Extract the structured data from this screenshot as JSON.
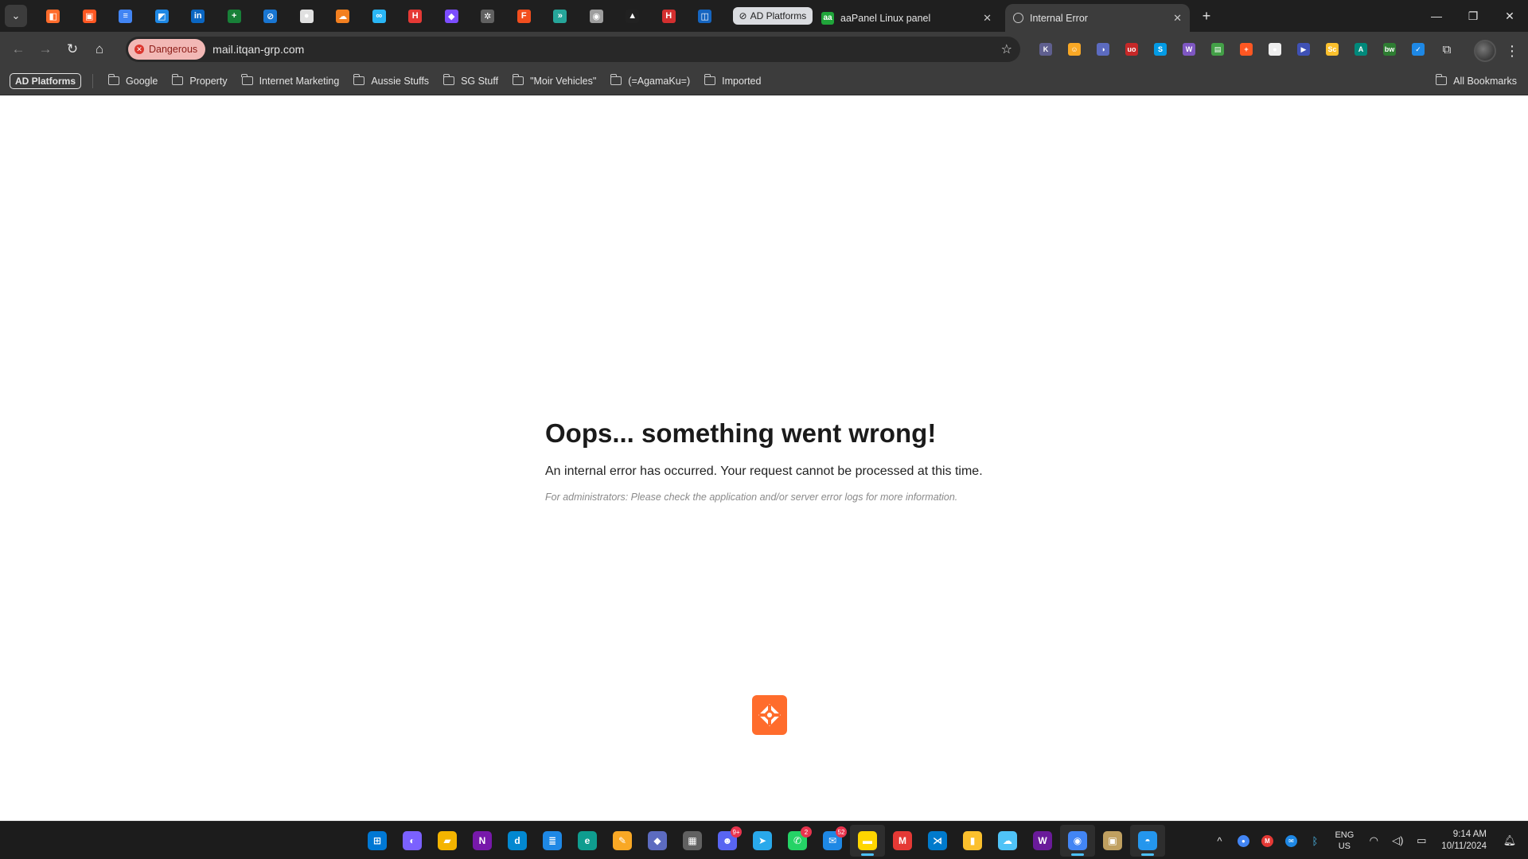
{
  "tabs": {
    "pinned_icons": [
      {
        "name": "pinned-tab-icon-1",
        "glyph": "◧",
        "color": "#ff6c2c"
      },
      {
        "name": "pinned-tab-icon-2",
        "glyph": "▣",
        "color": "#ff5722"
      },
      {
        "name": "pinned-tab-icon-3",
        "glyph": "≡",
        "color": "#4285f4"
      },
      {
        "name": "pinned-tab-icon-4",
        "glyph": "◩",
        "color": "#1e88e5"
      },
      {
        "name": "pinned-tab-icon-5",
        "glyph": "in",
        "color": "#0a66c2"
      },
      {
        "name": "pinned-tab-icon-6",
        "glyph": "+",
        "color": "#188038"
      },
      {
        "name": "pinned-tab-icon-7",
        "glyph": "⊘",
        "color": "#1976d2"
      },
      {
        "name": "pinned-tab-icon-8",
        "glyph": "●",
        "color": "#e0e0e0"
      },
      {
        "name": "pinned-tab-icon-9",
        "glyph": "☁",
        "color": "#f38020"
      },
      {
        "name": "pinned-tab-icon-10",
        "glyph": "∞",
        "color": "#29b6f6"
      },
      {
        "name": "pinned-tab-icon-11",
        "glyph": "H",
        "color": "#e53935"
      },
      {
        "name": "pinned-tab-icon-12",
        "glyph": "◆",
        "color": "#7c4dff"
      },
      {
        "name": "pinned-tab-icon-13",
        "glyph": "✲",
        "color": "#616161"
      },
      {
        "name": "pinned-tab-icon-14",
        "glyph": "F",
        "color": "#f24e1e"
      },
      {
        "name": "pinned-tab-icon-15",
        "glyph": "»",
        "color": "#26a69a"
      },
      {
        "name": "pinned-tab-icon-16",
        "glyph": "◉",
        "color": "#9e9e9e"
      },
      {
        "name": "pinned-tab-icon-17",
        "glyph": "▲",
        "color": "#212121"
      },
      {
        "name": "pinned-tab-icon-18",
        "glyph": "H",
        "color": "#d32f2f"
      },
      {
        "name": "pinned-tab-icon-19",
        "glyph": "◫",
        "color": "#1565c0"
      }
    ],
    "group_label": "AD Platforms",
    "tab_aapanel_title": "aaPanel Linux panel",
    "tab_aapanel_fav": "aa",
    "tab_active_title": "Internal Error"
  },
  "toolbar": {
    "security_chip": "Dangerous",
    "url": "mail.itqan-grp.com",
    "extensions": [
      {
        "name": "ext-icon-1",
        "glyph": "K",
        "color": "#5f5f8f"
      },
      {
        "name": "ext-icon-2",
        "glyph": "☺",
        "color": "#f9a825"
      },
      {
        "name": "ext-icon-3",
        "glyph": "◑",
        "color": "#5c6bc0"
      },
      {
        "name": "ext-icon-4",
        "glyph": "uo",
        "color": "#c62828"
      },
      {
        "name": "ext-icon-5",
        "glyph": "S",
        "color": "#039be5"
      },
      {
        "name": "ext-icon-6",
        "glyph": "W",
        "color": "#7e57c2"
      },
      {
        "name": "ext-icon-7",
        "glyph": "▤",
        "color": "#43a047"
      },
      {
        "name": "ext-icon-8",
        "glyph": "+",
        "color": "#ff5722"
      },
      {
        "name": "ext-icon-9",
        "glyph": "●",
        "color": "#eeeeee"
      },
      {
        "name": "ext-icon-10",
        "glyph": "▶",
        "color": "#3f51b5"
      },
      {
        "name": "ext-icon-11",
        "glyph": "Sc",
        "color": "#fbc02d"
      },
      {
        "name": "ext-icon-12",
        "glyph": "A",
        "color": "#00897b"
      },
      {
        "name": "ext-icon-13",
        "glyph": "bw",
        "color": "#2e7d32"
      },
      {
        "name": "ext-icon-14",
        "glyph": "✓",
        "color": "#1e88e5"
      }
    ]
  },
  "bookmarks": {
    "group_label": "AD Platforms",
    "folders": [
      "Google",
      "Property",
      "Internet Marketing",
      "Aussie Stuffs",
      "SG Stuff",
      "\"Moir Vehicles\"",
      "(=AgamaKu=)",
      "Imported"
    ],
    "all_label": "All Bookmarks"
  },
  "page": {
    "title": "Oops... something went wrong!",
    "message": "An internal error has occurred. Your request cannot be processed at this time.",
    "admin_note": "For administrators: Please check the application and/or server error logs for more information."
  },
  "taskbar": {
    "apps": [
      {
        "name": "start-button",
        "glyph": "⊞",
        "color": "#0078d4",
        "active": false
      },
      {
        "name": "copilot-icon",
        "glyph": "◐",
        "color": "#7b61ff",
        "active": false
      },
      {
        "name": "file-explorer-icon",
        "glyph": "▰",
        "color": "#f4b400",
        "active": false
      },
      {
        "name": "onenote-icon",
        "glyph": "N",
        "color": "#7719aa",
        "active": false
      },
      {
        "name": "app-icon-d",
        "glyph": "d",
        "color": "#0288d1",
        "active": false
      },
      {
        "name": "notepad-icon",
        "glyph": "≣",
        "color": "#1e88e5",
        "active": false
      },
      {
        "name": "edge-icon",
        "glyph": "e",
        "color": "#0f9d8f",
        "active": false
      },
      {
        "name": "paint-icon",
        "glyph": "✎",
        "color": "#f9a825",
        "active": false
      },
      {
        "name": "app-icon-diamond",
        "glyph": "◆",
        "color": "#5c6bc0",
        "active": false
      },
      {
        "name": "calculator-icon",
        "glyph": "▦",
        "color": "#616161",
        "active": false
      },
      {
        "name": "discord-icon",
        "glyph": "☻",
        "color": "#5865f2",
        "active": false,
        "badge": "9+"
      },
      {
        "name": "telegram-icon",
        "glyph": "➤",
        "color": "#29a9eb",
        "active": false
      },
      {
        "name": "whatsapp-icon",
        "glyph": "✆",
        "color": "#25d366",
        "active": false,
        "badge": "2"
      },
      {
        "name": "messenger-icon",
        "glyph": "✉",
        "color": "#1e88e5",
        "active": false,
        "badge": "52"
      },
      {
        "name": "sticky-notes-icon",
        "glyph": "▬",
        "color": "#ffd600",
        "active": true
      },
      {
        "name": "mail-app-icon",
        "glyph": "M",
        "color": "#e53935",
        "active": false
      },
      {
        "name": "vscode-icon",
        "glyph": "⋊",
        "color": "#007acc",
        "active": false
      },
      {
        "name": "file-icon",
        "glyph": "▮",
        "color": "#fbc02d",
        "active": false
      },
      {
        "name": "cloud-app-icon",
        "glyph": "☁",
        "color": "#4fc3f7",
        "active": false
      },
      {
        "name": "app-icon-w",
        "glyph": "W",
        "color": "#6a1b9a",
        "active": false
      },
      {
        "name": "chrome-icon",
        "glyph": "◉",
        "color": "#4285f4",
        "active": true
      },
      {
        "name": "app-icon-tan",
        "glyph": "▣",
        "color": "#c0a060",
        "active": false
      },
      {
        "name": "docker-icon",
        "glyph": "◓",
        "color": "#2496ed",
        "active": true
      }
    ],
    "lang_line1": "ENG",
    "lang_line2": "US",
    "time": "9:14 AM",
    "date": "10/11/2024"
  }
}
